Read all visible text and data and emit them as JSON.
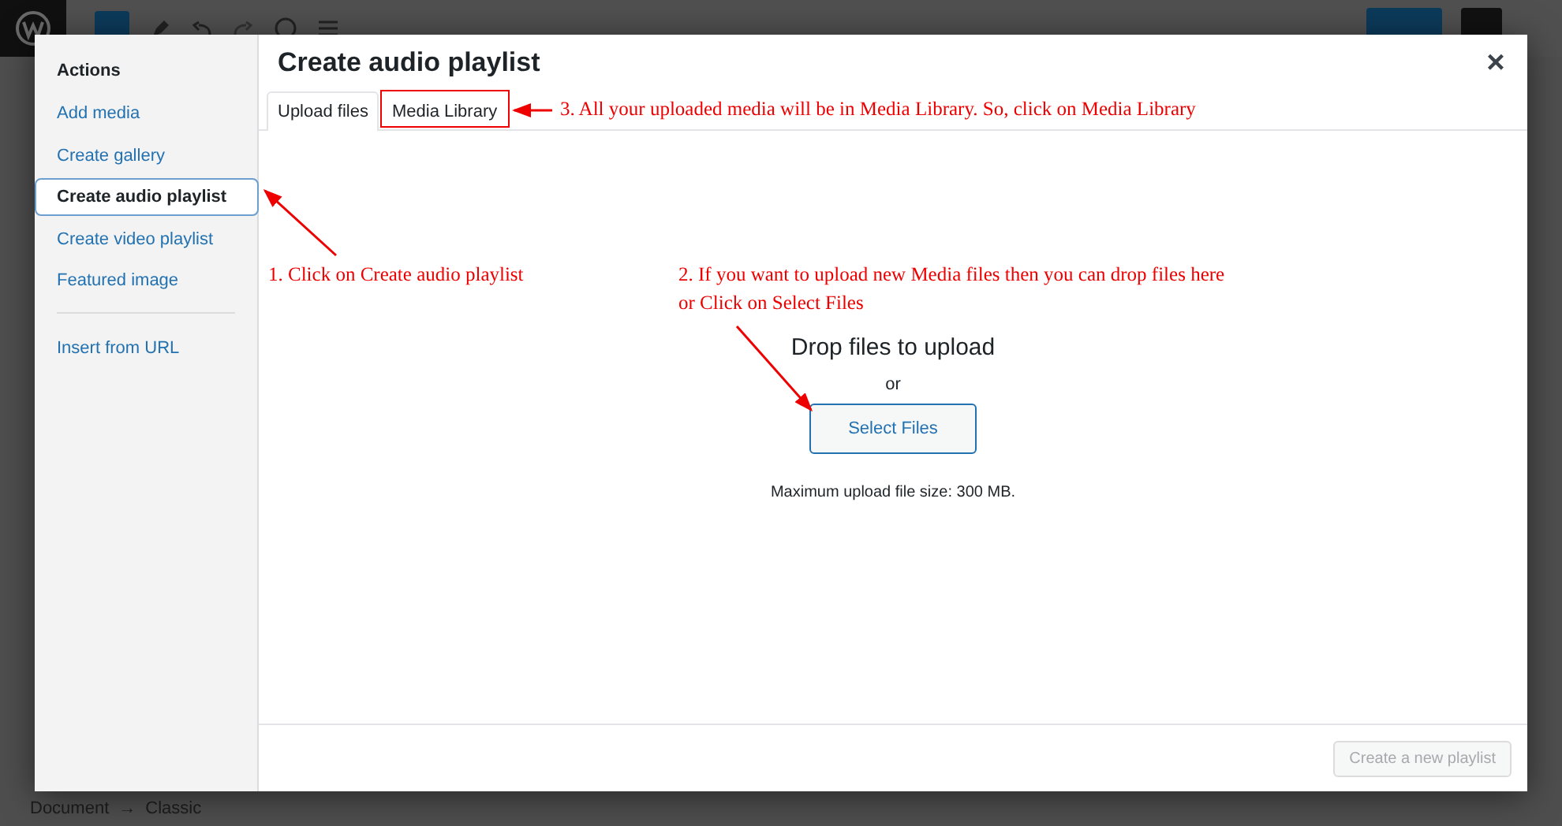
{
  "window": {
    "title": "Create audio playlist",
    "close": "×"
  },
  "sidebar": {
    "heading": "Actions",
    "items": [
      {
        "label": "Add media",
        "selected": false
      },
      {
        "label": "Create gallery",
        "selected": false
      },
      {
        "label": "Create audio playlist",
        "selected": true
      },
      {
        "label": "Create video playlist",
        "selected": false
      },
      {
        "label": "Featured image",
        "selected": false
      }
    ],
    "extra_items": [
      {
        "label": "Insert from URL",
        "selected": false
      }
    ]
  },
  "tabs": [
    {
      "label": "Upload files",
      "selected": true
    },
    {
      "label": "Media Library",
      "selected": false
    }
  ],
  "upload": {
    "heading": "Drop files to upload",
    "or": "or",
    "button": "Select Files",
    "note": "Maximum upload file size: 300 MB."
  },
  "footer": {
    "button": {
      "label": "Create a new playlist",
      "disabled": true
    }
  },
  "annotations": [
    {
      "lines": [
        "3. All your uploaded media will be in Media Library. So, click on Media Library"
      ]
    },
    {
      "lines": [
        "1. Click on Create audio playlist"
      ]
    },
    {
      "lines": [
        "2. If you want to upload new Media files then you can drop files here",
        "or Click on Select Files"
      ]
    }
  ],
  "breadcrumb": [
    "Document",
    "→",
    "Classic"
  ]
}
